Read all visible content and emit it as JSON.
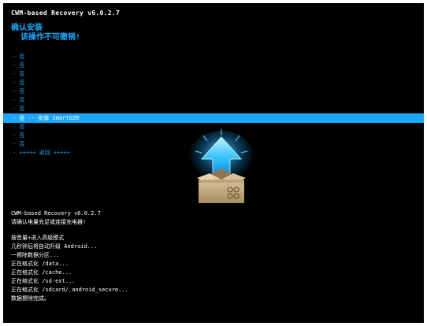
{
  "header": {
    "version": "CWM-based Recovery v6.0.2.7",
    "confirm_title": "确认安装",
    "confirm_subtitle": "该操作不可撤销!"
  },
  "menu": {
    "items": [
      {
        "label": "- 否",
        "selected": false
      },
      {
        "label": "- 否",
        "selected": false
      },
      {
        "label": "- 否",
        "selected": false
      },
      {
        "label": "- 否",
        "selected": false
      },
      {
        "label": "- 否",
        "selected": false
      },
      {
        "label": "- 否",
        "selected": false
      },
      {
        "label": "- 否",
        "selected": false
      },
      {
        "label": "- 是 -- 安装 SmartGZB",
        "selected": true
      },
      {
        "label": "- 否",
        "selected": false
      },
      {
        "label": "- 否",
        "selected": false
      },
      {
        "label": "- 否",
        "selected": false
      },
      {
        "label": "- +++++ 返回 +++++",
        "selected": false
      }
    ]
  },
  "log": {
    "version": "CWM-based Recovery v6.0.2.7",
    "battery_warning": "请确认电量充足或连接充电器!",
    "lines": [
      "按音量+进入高级模式",
      "几秒钟后将自动升级 Android...",
      "一擦除数据分区...",
      "正在格式化 /data...",
      "正在格式化 /cache...",
      "正在格式化 /sd-ext...",
      "正在格式化 /sdcard/.android_secure...",
      "数据擦除完成。"
    ]
  },
  "logo": {
    "icon": "upload-box-icon"
  },
  "colors": {
    "background": "#000000",
    "accent": "#1aa8ff",
    "text": "#ffffff",
    "box": "#cbb38b"
  }
}
